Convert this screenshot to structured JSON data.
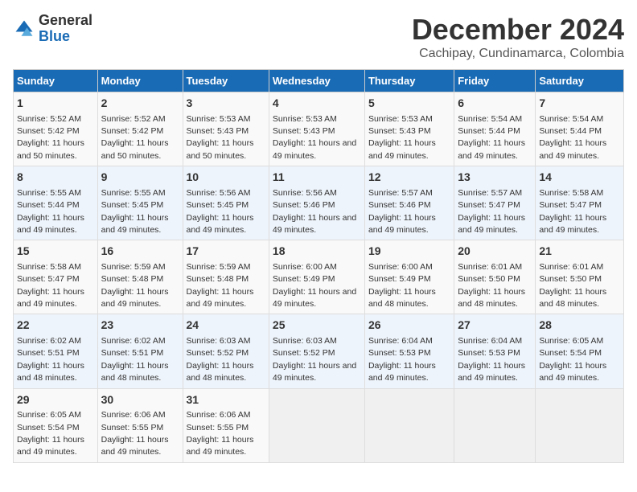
{
  "logo": {
    "general": "General",
    "blue": "Blue"
  },
  "title": "December 2024",
  "subtitle": "Cachipay, Cundinamarca, Colombia",
  "headers": [
    "Sunday",
    "Monday",
    "Tuesday",
    "Wednesday",
    "Thursday",
    "Friday",
    "Saturday"
  ],
  "weeks": [
    [
      {
        "day": "1",
        "sunrise": "Sunrise: 5:52 AM",
        "sunset": "Sunset: 5:42 PM",
        "daylight": "Daylight: 11 hours and 50 minutes."
      },
      {
        "day": "2",
        "sunrise": "Sunrise: 5:52 AM",
        "sunset": "Sunset: 5:42 PM",
        "daylight": "Daylight: 11 hours and 50 minutes."
      },
      {
        "day": "3",
        "sunrise": "Sunrise: 5:53 AM",
        "sunset": "Sunset: 5:43 PM",
        "daylight": "Daylight: 11 hours and 50 minutes."
      },
      {
        "day": "4",
        "sunrise": "Sunrise: 5:53 AM",
        "sunset": "Sunset: 5:43 PM",
        "daylight": "Daylight: 11 hours and 49 minutes."
      },
      {
        "day": "5",
        "sunrise": "Sunrise: 5:53 AM",
        "sunset": "Sunset: 5:43 PM",
        "daylight": "Daylight: 11 hours and 49 minutes."
      },
      {
        "day": "6",
        "sunrise": "Sunrise: 5:54 AM",
        "sunset": "Sunset: 5:44 PM",
        "daylight": "Daylight: 11 hours and 49 minutes."
      },
      {
        "day": "7",
        "sunrise": "Sunrise: 5:54 AM",
        "sunset": "Sunset: 5:44 PM",
        "daylight": "Daylight: 11 hours and 49 minutes."
      }
    ],
    [
      {
        "day": "8",
        "sunrise": "Sunrise: 5:55 AM",
        "sunset": "Sunset: 5:44 PM",
        "daylight": "Daylight: 11 hours and 49 minutes."
      },
      {
        "day": "9",
        "sunrise": "Sunrise: 5:55 AM",
        "sunset": "Sunset: 5:45 PM",
        "daylight": "Daylight: 11 hours and 49 minutes."
      },
      {
        "day": "10",
        "sunrise": "Sunrise: 5:56 AM",
        "sunset": "Sunset: 5:45 PM",
        "daylight": "Daylight: 11 hours and 49 minutes."
      },
      {
        "day": "11",
        "sunrise": "Sunrise: 5:56 AM",
        "sunset": "Sunset: 5:46 PM",
        "daylight": "Daylight: 11 hours and 49 minutes."
      },
      {
        "day": "12",
        "sunrise": "Sunrise: 5:57 AM",
        "sunset": "Sunset: 5:46 PM",
        "daylight": "Daylight: 11 hours and 49 minutes."
      },
      {
        "day": "13",
        "sunrise": "Sunrise: 5:57 AM",
        "sunset": "Sunset: 5:47 PM",
        "daylight": "Daylight: 11 hours and 49 minutes."
      },
      {
        "day": "14",
        "sunrise": "Sunrise: 5:58 AM",
        "sunset": "Sunset: 5:47 PM",
        "daylight": "Daylight: 11 hours and 49 minutes."
      }
    ],
    [
      {
        "day": "15",
        "sunrise": "Sunrise: 5:58 AM",
        "sunset": "Sunset: 5:47 PM",
        "daylight": "Daylight: 11 hours and 49 minutes."
      },
      {
        "day": "16",
        "sunrise": "Sunrise: 5:59 AM",
        "sunset": "Sunset: 5:48 PM",
        "daylight": "Daylight: 11 hours and 49 minutes."
      },
      {
        "day": "17",
        "sunrise": "Sunrise: 5:59 AM",
        "sunset": "Sunset: 5:48 PM",
        "daylight": "Daylight: 11 hours and 49 minutes."
      },
      {
        "day": "18",
        "sunrise": "Sunrise: 6:00 AM",
        "sunset": "Sunset: 5:49 PM",
        "daylight": "Daylight: 11 hours and 49 minutes."
      },
      {
        "day": "19",
        "sunrise": "Sunrise: 6:00 AM",
        "sunset": "Sunset: 5:49 PM",
        "daylight": "Daylight: 11 hours and 48 minutes."
      },
      {
        "day": "20",
        "sunrise": "Sunrise: 6:01 AM",
        "sunset": "Sunset: 5:50 PM",
        "daylight": "Daylight: 11 hours and 48 minutes."
      },
      {
        "day": "21",
        "sunrise": "Sunrise: 6:01 AM",
        "sunset": "Sunset: 5:50 PM",
        "daylight": "Daylight: 11 hours and 48 minutes."
      }
    ],
    [
      {
        "day": "22",
        "sunrise": "Sunrise: 6:02 AM",
        "sunset": "Sunset: 5:51 PM",
        "daylight": "Daylight: 11 hours and 48 minutes."
      },
      {
        "day": "23",
        "sunrise": "Sunrise: 6:02 AM",
        "sunset": "Sunset: 5:51 PM",
        "daylight": "Daylight: 11 hours and 48 minutes."
      },
      {
        "day": "24",
        "sunrise": "Sunrise: 6:03 AM",
        "sunset": "Sunset: 5:52 PM",
        "daylight": "Daylight: 11 hours and 48 minutes."
      },
      {
        "day": "25",
        "sunrise": "Sunrise: 6:03 AM",
        "sunset": "Sunset: 5:52 PM",
        "daylight": "Daylight: 11 hours and 49 minutes."
      },
      {
        "day": "26",
        "sunrise": "Sunrise: 6:04 AM",
        "sunset": "Sunset: 5:53 PM",
        "daylight": "Daylight: 11 hours and 49 minutes."
      },
      {
        "day": "27",
        "sunrise": "Sunrise: 6:04 AM",
        "sunset": "Sunset: 5:53 PM",
        "daylight": "Daylight: 11 hours and 49 minutes."
      },
      {
        "day": "28",
        "sunrise": "Sunrise: 6:05 AM",
        "sunset": "Sunset: 5:54 PM",
        "daylight": "Daylight: 11 hours and 49 minutes."
      }
    ],
    [
      {
        "day": "29",
        "sunrise": "Sunrise: 6:05 AM",
        "sunset": "Sunset: 5:54 PM",
        "daylight": "Daylight: 11 hours and 49 minutes."
      },
      {
        "day": "30",
        "sunrise": "Sunrise: 6:06 AM",
        "sunset": "Sunset: 5:55 PM",
        "daylight": "Daylight: 11 hours and 49 minutes."
      },
      {
        "day": "31",
        "sunrise": "Sunrise: 6:06 AM",
        "sunset": "Sunset: 5:55 PM",
        "daylight": "Daylight: 11 hours and 49 minutes."
      },
      null,
      null,
      null,
      null
    ]
  ]
}
